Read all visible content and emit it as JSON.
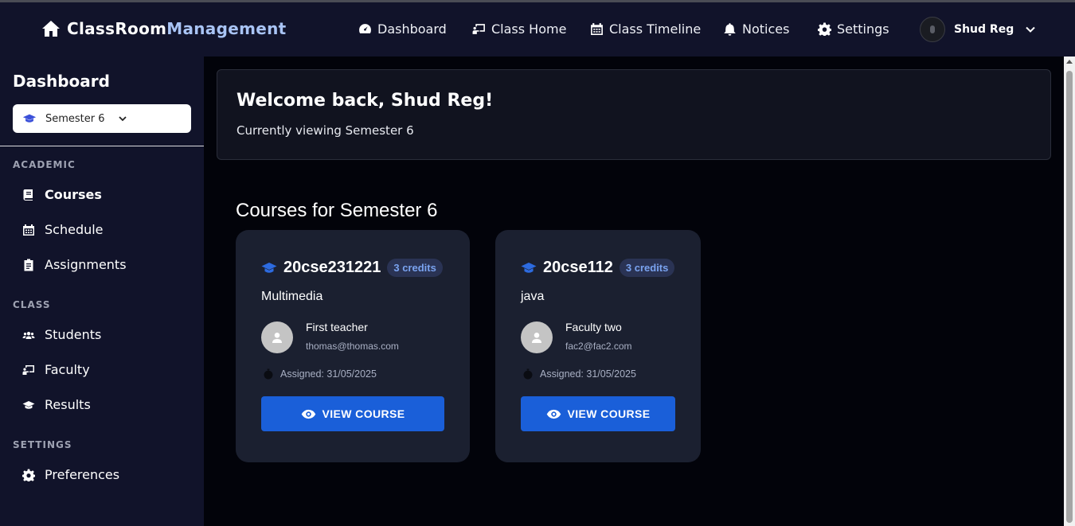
{
  "brand": {
    "part1": "ClassRoom",
    "part2": "Management"
  },
  "nav": {
    "items": [
      {
        "label": "Dashboard",
        "icon": "gauge-icon"
      },
      {
        "label": "Class Home",
        "icon": "chalkboard-teacher-icon"
      },
      {
        "label": "Class Timeline",
        "icon": "calendar-icon"
      },
      {
        "label": "Notices",
        "icon": "bell-icon"
      },
      {
        "label": "Settings",
        "icon": "gear-icon"
      }
    ],
    "user_name": "Shud Reg"
  },
  "sidebar": {
    "title": "Dashboard",
    "semester_select": "Semester 6",
    "sections": [
      {
        "label": "ACADEMIC",
        "items": [
          {
            "label": "Courses",
            "active": true
          },
          {
            "label": "Schedule"
          },
          {
            "label": "Assignments"
          }
        ]
      },
      {
        "label": "CLASS",
        "items": [
          {
            "label": "Students"
          },
          {
            "label": "Faculty"
          },
          {
            "label": "Results"
          }
        ]
      },
      {
        "label": "SETTINGS",
        "items": [
          {
            "label": "Preferences"
          }
        ]
      }
    ]
  },
  "welcome": {
    "title": "Welcome back, Shud Reg!",
    "subtitle": "Currently viewing Semester 6"
  },
  "courses": {
    "title": "Courses for Semester 6",
    "cards": [
      {
        "code": "20cse231221",
        "credits": "3 credits",
        "name": "Multimedia",
        "teacher": "First teacher",
        "email": "thomas@thomas.com",
        "assigned": "Assigned: 31/05/2025",
        "button": "VIEW COURSE"
      },
      {
        "code": "20cse112",
        "credits": "3 credits",
        "name": "java",
        "teacher": "Faculty two",
        "email": "fac2@fac2.com",
        "assigned": "Assigned: 31/05/2025",
        "button": "VIEW COURSE"
      }
    ]
  },
  "colors": {
    "navbar_bg": "#11132a",
    "page_bg": "#02030a",
    "card_bg": "#1b2030",
    "accent_blue": "#1a5fd9",
    "brand_highlight": "#a9c4f5"
  }
}
